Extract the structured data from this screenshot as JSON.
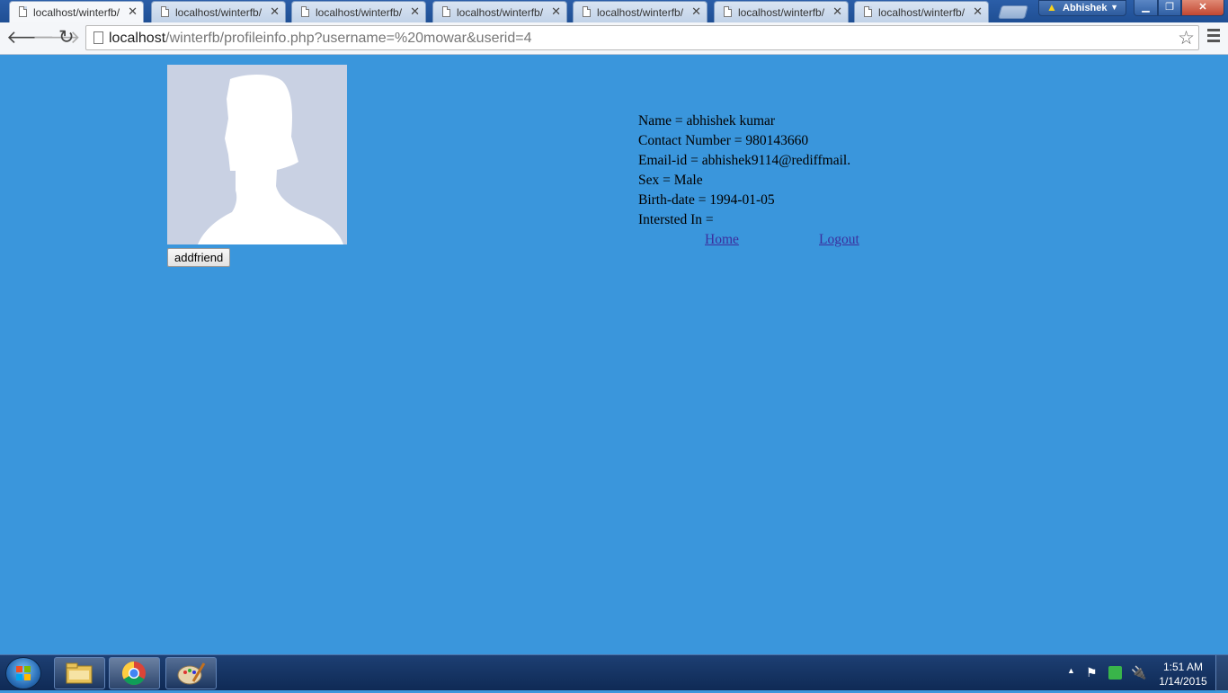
{
  "browser": {
    "tabs": [
      {
        "title": "localhost/winterfb/",
        "active": true
      },
      {
        "title": "localhost/winterfb/",
        "active": false
      },
      {
        "title": "localhost/winterfb/",
        "active": false
      },
      {
        "title": "localhost/winterfb/",
        "active": false
      },
      {
        "title": "localhost/winterfb/",
        "active": false
      },
      {
        "title": "localhost/winterfb/",
        "active": false
      },
      {
        "title": "localhost/winterfb/",
        "active": false
      }
    ],
    "tab_close_glyph": "✕",
    "profile_name": "Abhishek",
    "url_host": "localhost",
    "url_path": "/winterfb/profileinfo.php?username=%20mowar&userid=4"
  },
  "page": {
    "background_color": "#3a96dc",
    "addfriend_label": "addfriend",
    "info": {
      "name": "Name = abhishek kumar",
      "contact": "Contact Number = 980143660",
      "email": "Email-id = abhishek9114@rediffmail.",
      "sex": "Sex = Male",
      "birthdate": "Birth-date = 1994-01-05",
      "interested": "Intersted In ="
    },
    "links": {
      "home": "Home",
      "logout": "Logout"
    }
  },
  "taskbar": {
    "apps": [
      "explorer-icon",
      "chrome-icon",
      "paint-icon"
    ],
    "clock_time": "1:51 AM",
    "clock_date": "1/14/2015"
  }
}
